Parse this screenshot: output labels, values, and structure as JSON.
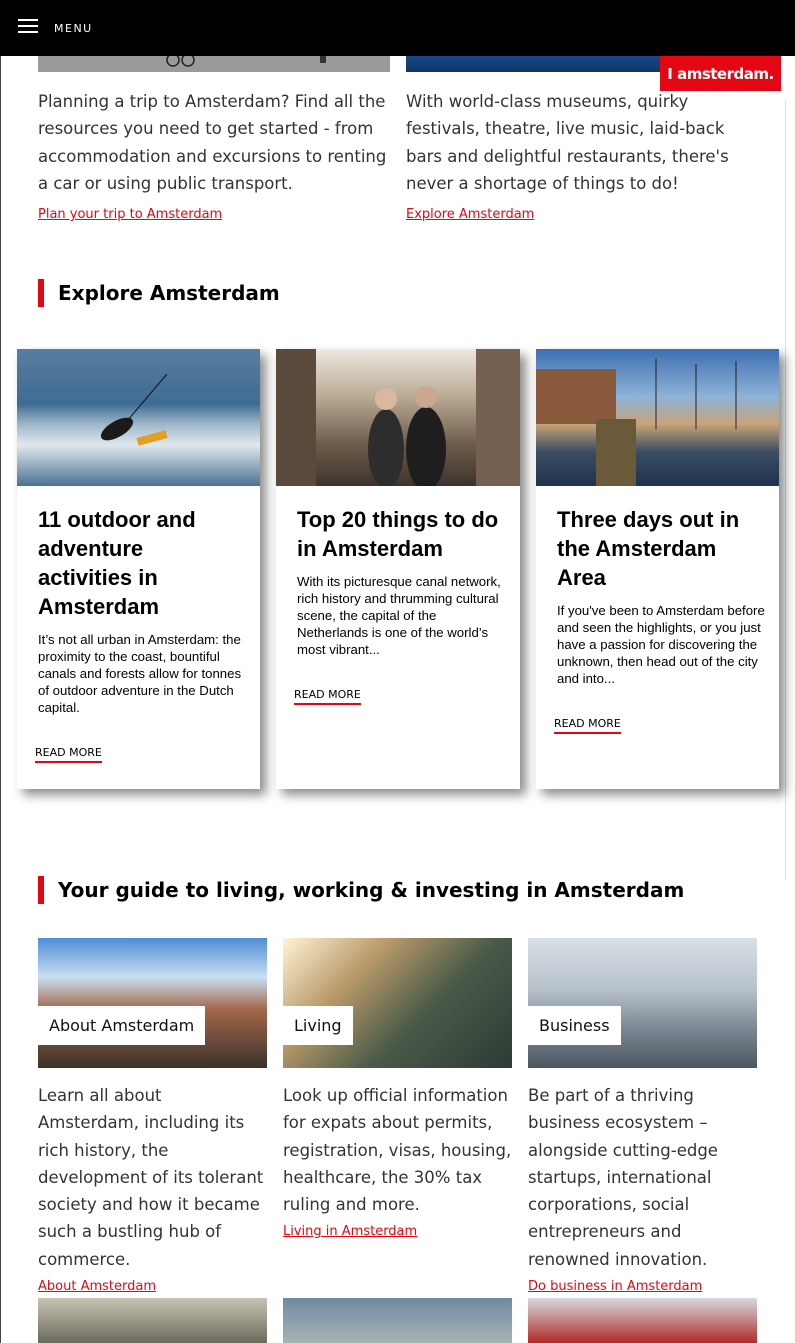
{
  "header": {
    "menu_label": "MENU",
    "logo_text": "I amsterdam."
  },
  "intro": {
    "left": {
      "text": "Planning a trip to Amsterdam? Find all the resources you need to get started - from accommodation and excursions to renting a car or using public transport.",
      "link": "Plan your trip to Amsterdam"
    },
    "right": {
      "text": "With world-class museums, quirky festivals, theatre, live music, laid-back bars and delightful restaurants, there's never a shortage of things to do!",
      "link": "Explore Amsterdam"
    }
  },
  "explore": {
    "heading": "Explore Amsterdam",
    "cards": [
      {
        "title": "11 outdoor and adventure activities in Amsterdam",
        "text": "It’s not all urban in Amsterdam: the proximity to the coast, bountiful canals and forests allow for tonnes of outdoor adventure in the Dutch capital.",
        "more": "READ MORE"
      },
      {
        "title": "Top 20 things to do in Amsterdam",
        "text": "With its picturesque canal network, rich history and thrumming cultural scene, the capital of the Netherlands is one of the world’s most vibrant...",
        "more": "READ MORE"
      },
      {
        "title": "Three days out in the Amsterdam Area",
        "text": "If you've been to Amsterdam before and seen the highlights, or you just have a passion for discovering the unknown, then head out of the city and into...",
        "more": "READ MORE"
      }
    ]
  },
  "guide": {
    "heading": "Your guide to living, working & investing in Amsterdam",
    "tiles": [
      {
        "tag": "About Amsterdam",
        "text": "Learn all about Amsterdam, including its rich history, the development of its tolerant society and how it became such a bustling hub of commerce.",
        "link": "About Amsterdam"
      },
      {
        "tag": "Living",
        "text": "Look up official information for expats about permits, registration, visas, housing, healthcare, the 30% tax ruling and more.",
        "link": "Living in Amsterdam"
      },
      {
        "tag": "Business",
        "text": "Be part of a thriving business ecosystem – alongside cutting-edge startups, international corporations, social entrepreneurs and renowned innovation.",
        "link": "Do business in Amsterdam"
      }
    ]
  },
  "colors": {
    "accent": "#e30613",
    "topbar": "#000000"
  }
}
